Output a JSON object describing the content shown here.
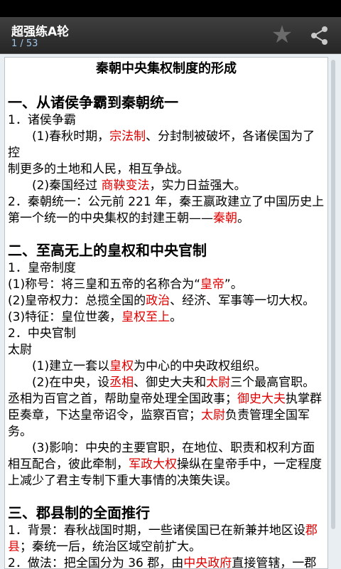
{
  "header": {
    "title": "超强练A轮",
    "pager": "1 / 53",
    "star_icon": "star-icon",
    "share_icon": "share-icon"
  },
  "doc": {
    "title": "秦朝中央集权制度的形成",
    "s1": {
      "heading": "一、从诸侯争霸到秦朝统一",
      "l1": "1．诸侯争霸",
      "l2a": "(1)春秋时期，",
      "l2r": "宗法制",
      "l2b": "、分封制被破坏，各诸侯国为了控",
      "l3": "制更多的土地和人民，相互争战。",
      "l4a": "(2)秦国经过 ",
      "l4r": "商鞅变法",
      "l4b": "，实力日益强大。",
      "l5": "2．秦朝统一：公元前 221 年，秦王嬴政建立了中国历史上第一个统一的中央集权的封建王朝——",
      "l5r": "秦朝",
      "l5b": "。"
    },
    "s2": {
      "heading": "二、至高无上的皇权和中央官制",
      "l1": "1．皇帝制度",
      "l2a": "(1)称号：将三皇和五帝的名称合为“",
      "l2r": "皇帝",
      "l2b": "”。",
      "l3a": "(2)皇帝权力：总揽全国的",
      "l3r": "政治",
      "l3b": "、经济、军事等一切大权。",
      "l4a": "(3)特征：皇位世袭，",
      "l4r": "皇权至上",
      "l4b": "。",
      "l5": "2．中央官制",
      "l6": "太尉",
      "l7a": "(1)建立一套以",
      "l7r": "皇权",
      "l7b": "为中心的中央政权组织。",
      "l8a": "(2)在中央，设",
      "l8r1": "丞相",
      "l8b": "、御史大夫和",
      "l8r2": "太尉",
      "l8c": "三个最高官职。",
      "l9a": "丞相为百官之首，帮助皇帝处理全国政事；",
      "l9r1": "御史大夫",
      "l9b": "执掌群臣奏章，下达皇帝诏令，监察百官；",
      "l9r2": "太尉",
      "l9c": "负责管理全国军务。",
      "l10a": "(3)影响：中央的主要官职，在地位、职责和权利方面相互配合，彼此牵制，",
      "l10r": "军政大权",
      "l10b": "操纵在皇帝手中，一定程度上减少了君主专制下重大事情的决策失误。"
    },
    "s3": {
      "heading": "三、郡县制的全面推行",
      "l1a": "1．背景：春秋战国时期，一些诸侯国已在新兼并地区设",
      "l1r": "郡县",
      "l1b": "；秦统一后，统治区域空前扩大。",
      "l2a": "2．做法：把全国分为 36 郡，由",
      "l2r": "中央政府",
      "l2b": "直接管辖，一郡"
    }
  },
  "colors": {
    "accent": "#e00000",
    "appbar": "#2f2f2f",
    "pager": "#9fc6e8"
  }
}
